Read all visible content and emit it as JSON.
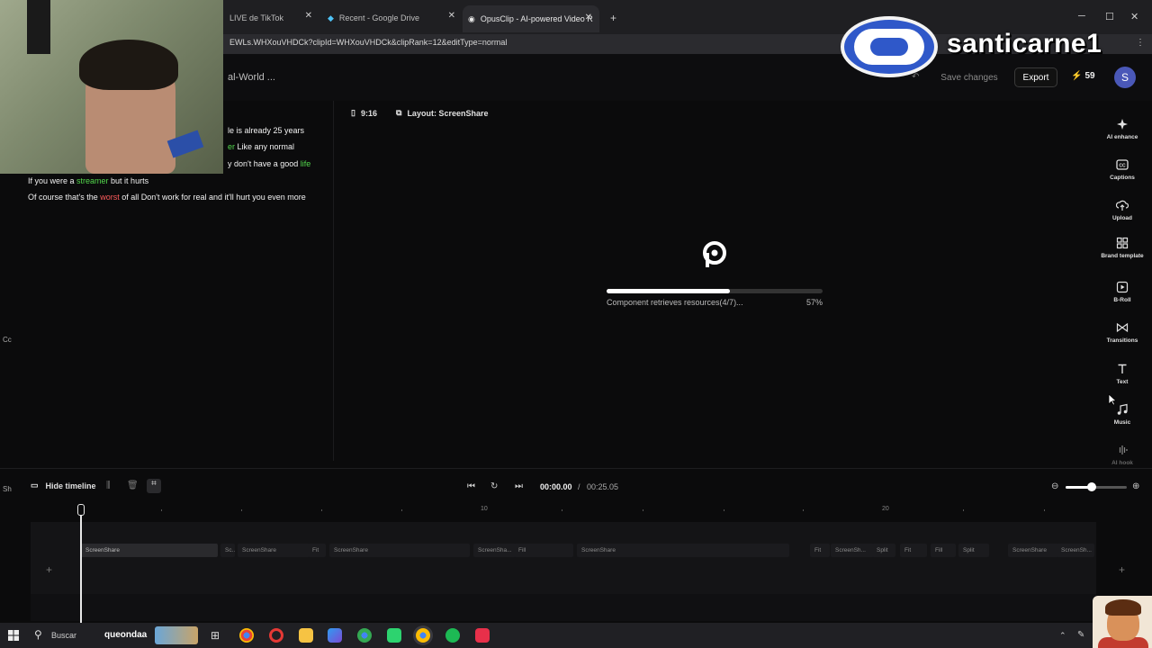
{
  "browser": {
    "tabs": [
      {
        "title": "LIVE de TikTok"
      },
      {
        "title": "Recent - Google Drive"
      },
      {
        "title": "OpusClip - AI-powered Video R"
      }
    ],
    "new_tab": "+",
    "url": "EWLs.WHXouVHDCk?clipId=WHXouVHDCk&clipRank=12&editType=normal",
    "window_controls": {
      "minimize": "─",
      "maximize": "☐",
      "close": "✕"
    }
  },
  "header": {
    "project_title": "al-World ...",
    "save_label": "Save changes",
    "export_label": "Export",
    "credits": "59",
    "avatar_letter": "S"
  },
  "watermark": {
    "name": "santicarne1"
  },
  "captions": [
    {
      "parts": [
        {
          "t": "le is already 25 years",
          "c": ""
        }
      ]
    },
    {
      "parts": [
        {
          "t": "er ",
          "c": "g"
        },
        {
          "t": "Like any normal",
          "c": ""
        }
      ]
    },
    {
      "parts": [
        {
          "t": "y don't have a good ",
          "c": ""
        },
        {
          "t": "life",
          "c": "g"
        }
      ]
    },
    {
      "parts": [
        {
          "t": "If you were a ",
          "c": ""
        },
        {
          "t": "streamer",
          "c": "g"
        },
        {
          "t": " but it hurts",
          "c": ""
        }
      ]
    },
    {
      "parts": [
        {
          "t": "Of course that's the ",
          "c": ""
        },
        {
          "t": "worst",
          "c": "r"
        },
        {
          "t": " of all Don't work for real and it'll hurt you even more",
          "c": ""
        }
      ]
    }
  ],
  "edge_labels": {
    "left_mid": "Cc",
    "left_low": "Sh"
  },
  "canvas": {
    "ratio_label": "9:16",
    "layout_label": "Layout: ScreenShare",
    "loading_text": "Component retrieves resources(4/7)...",
    "progress_pct": 57,
    "progress_label": "57%"
  },
  "sidebar": {
    "items": [
      {
        "label": "AI enhance",
        "icon": "sparkle-icon"
      },
      {
        "label": "Captions",
        "icon": "cc-icon"
      },
      {
        "label": "Upload",
        "icon": "upload-icon"
      },
      {
        "label": "Brand template",
        "icon": "brand-template-icon"
      },
      {
        "label": "B-Roll",
        "icon": "broll-icon"
      },
      {
        "label": "Transitions",
        "icon": "transitions-icon"
      },
      {
        "label": "Text",
        "icon": "text-icon"
      },
      {
        "label": "Music",
        "icon": "music-icon"
      },
      {
        "label": "AI hook",
        "icon": "ai-hook-icon"
      }
    ]
  },
  "timeline": {
    "hide_label": "Hide timeline",
    "current_time": "00:00.00",
    "separator": "/",
    "total_time": "00:25.05",
    "zoom_level": 0.42,
    "ruler_labels": [
      "10",
      "20"
    ],
    "clips": [
      {
        "label": "ScreenShare"
      },
      {
        "label": "Sc..."
      },
      {
        "label": "ScreenShare"
      },
      {
        "label": "Fit"
      },
      {
        "label": "ScreenShare"
      },
      {
        "label": "ScreenSha..."
      },
      {
        "label": "Fill"
      },
      {
        "label": "ScreenShare"
      },
      {
        "label": "Fit"
      },
      {
        "label": "ScreenSh..."
      },
      {
        "label": "Split"
      },
      {
        "label": "Fit"
      },
      {
        "label": "Fill"
      },
      {
        "label": "Split"
      },
      {
        "label": "ScreenShare"
      },
      {
        "label": "ScreenSh..."
      }
    ]
  },
  "taskbar": {
    "search_text": "Buscar",
    "username": "queondaa"
  }
}
